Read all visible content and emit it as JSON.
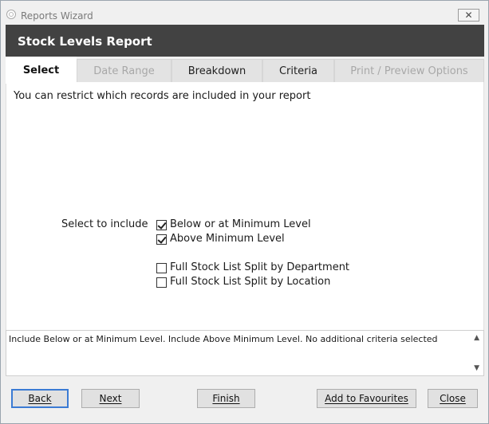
{
  "window": {
    "title": "Reports Wizard",
    "close_glyph": "✕"
  },
  "header": {
    "title": "Stock Levels Report"
  },
  "tabs": [
    {
      "label": "Select",
      "state": "active"
    },
    {
      "label": "Date Range",
      "state": "disabled"
    },
    {
      "label": "Breakdown",
      "state": "enabled"
    },
    {
      "label": "Criteria",
      "state": "enabled"
    },
    {
      "label": "Print / Preview Options",
      "state": "disabled"
    }
  ],
  "panel": {
    "intro": "You can restrict which records are included in your report",
    "select_label": "Select to include",
    "options": [
      {
        "label": "Below or at Minimum Level",
        "checked": true
      },
      {
        "label": "Above Minimum Level",
        "checked": true
      },
      {
        "label": "Full Stock List Split by Department",
        "checked": false
      },
      {
        "label": "Full Stock List Split by Location",
        "checked": false
      }
    ]
  },
  "summary": {
    "text": "Include Below or at Minimum Level. Include Above Minimum Level. No additional criteria selected"
  },
  "buttons": {
    "back": "Back",
    "next": "Next",
    "finish": "Finish",
    "add_to_favourites": "Add to Favourites",
    "close": "Close"
  },
  "icons": {
    "app": "app-icon",
    "scroll_up": "▲",
    "scroll_down": "▼"
  },
  "colors": {
    "header": "#424242",
    "default_button_border": "#3b7bd4"
  }
}
